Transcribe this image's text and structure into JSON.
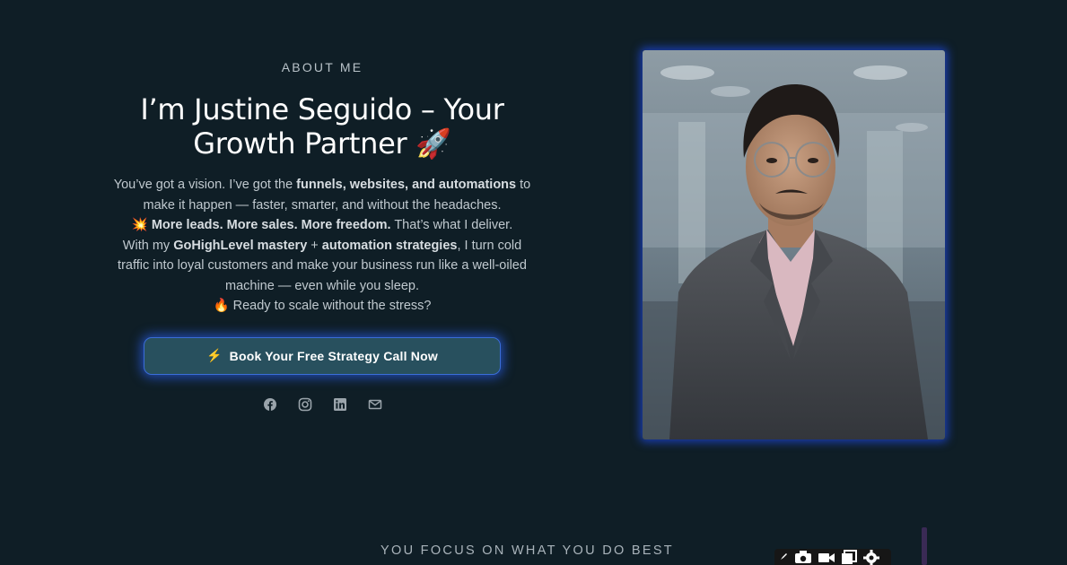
{
  "about": {
    "eyebrow": "ABOUT ME",
    "title_line1": "I’m Justine Seguido – Your",
    "title_line2": "Growth Partner",
    "title_emoji": "🚀"
  },
  "bio": {
    "p1_a": "You’ve got a vision. I’ve got the ",
    "p1_b": "funnels, websites, and automations",
    "p1_c": " to make it happen — faster, smarter, and without the headaches.",
    "p2_emoji": "💥",
    "p2_b": "More leads. More sales. More freedom.",
    "p2_c": " That’s what I deliver.",
    "p3_a": "With my ",
    "p3_b1": "GoHighLevel mastery",
    "p3_c": " + ",
    "p3_b2": "automation strategies",
    "p3_d": ", I turn cold traffic into loyal customers and make your business run like a well-oiled machine — even while you sleep.",
    "p4_emoji": "🔥",
    "p4_text": " Ready to scale without the stress?"
  },
  "cta": {
    "icon": "⚡",
    "label": "Book Your Free Strategy Call Now"
  },
  "socials": [
    "facebook-icon",
    "instagram-icon",
    "linkedin-icon",
    "mail-icon"
  ],
  "section2": {
    "eyebrow": "YOU FOCUS ON WHAT YOU DO BEST"
  },
  "colors": {
    "background": "#0f1e26",
    "button": "#28505e",
    "glow": "#2a5ae0"
  }
}
